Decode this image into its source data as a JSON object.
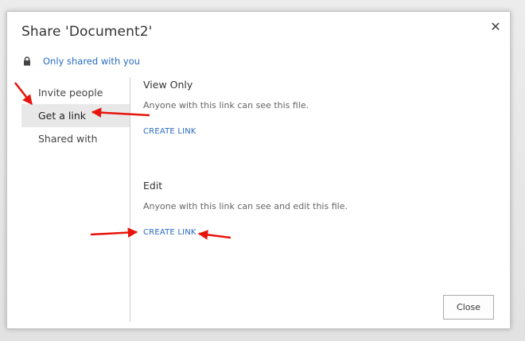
{
  "dialog": {
    "title": "Share 'Document2'",
    "close_icon": "close-icon",
    "close_glyph": "✕",
    "sharing_status": "Only shared with you",
    "status_icon": "lock-icon"
  },
  "nav": {
    "items": [
      {
        "label": "Invite people"
      },
      {
        "label": "Get a link",
        "selected": true
      },
      {
        "label": "Shared with"
      }
    ]
  },
  "sections": [
    {
      "heading": "View Only",
      "description": "Anyone with this link can see this file.",
      "action": "CREATE LINK"
    },
    {
      "heading": "Edit",
      "description": "Anyone with this link can see and edit this file.",
      "action": "CREATE LINK"
    }
  ],
  "footer": {
    "close_label": "Close"
  },
  "annotations": {
    "arrow_color": "#e8140c"
  },
  "colors": {
    "link": "#2a6cc0",
    "selected_bg": "#e8e8e8"
  }
}
